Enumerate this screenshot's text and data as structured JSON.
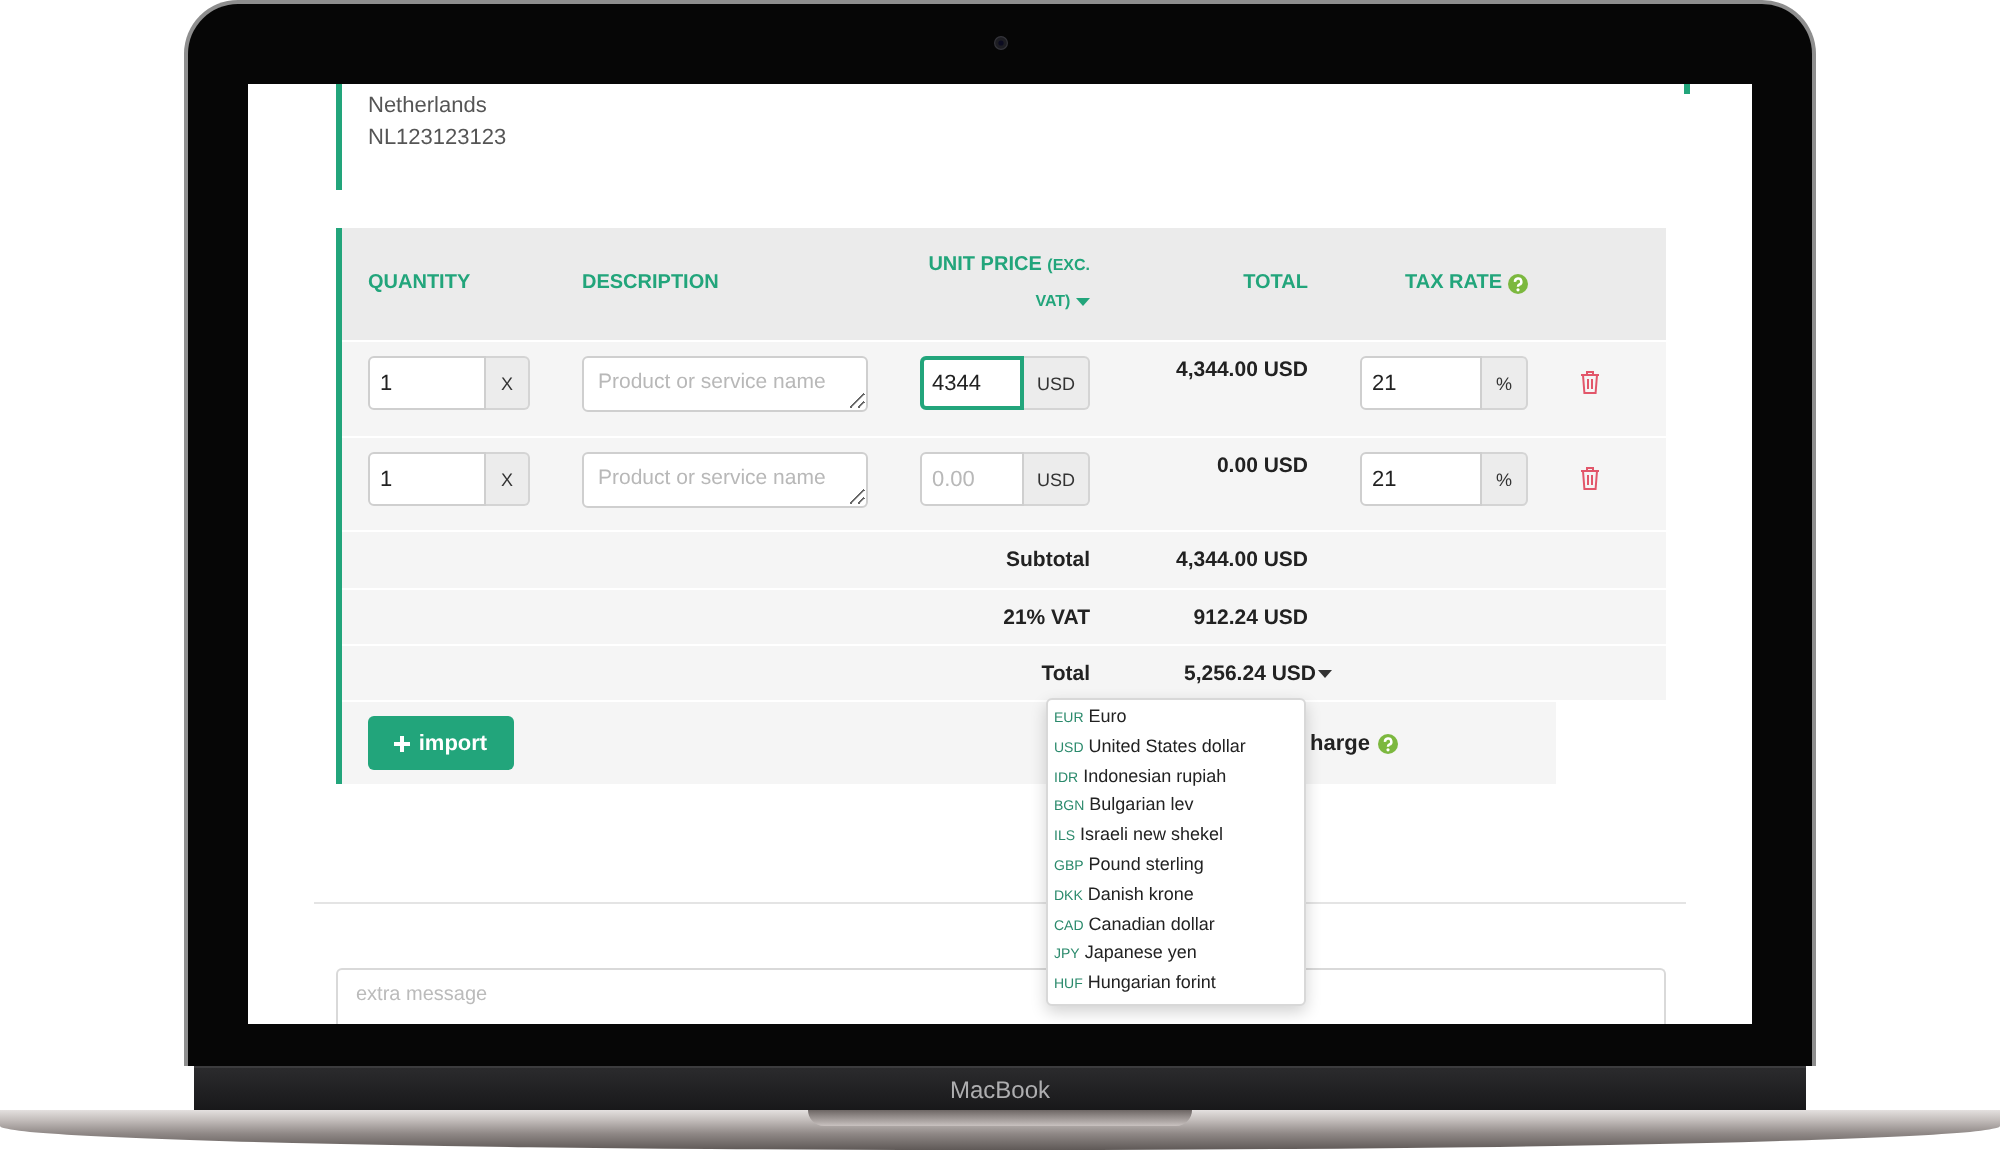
{
  "device": {
    "label": "MacBook"
  },
  "address": {
    "lines": [
      "Netherlands",
      "NL123123123"
    ]
  },
  "invoice_table": {
    "columns": [
      {
        "label": "QUANTITY",
        "kind": "plain"
      },
      {
        "label": "DESCRIPTION",
        "kind": "plain"
      },
      {
        "label": "UNIT PRICE",
        "note": "(EXC. VAT)",
        "kind": "dropdown"
      },
      {
        "label": "TOTAL",
        "kind": "plain"
      },
      {
        "label": "TAX RATE",
        "kind": "help"
      }
    ],
    "rows": [
      {
        "quantity": {
          "value": "1",
          "addon": "X"
        },
        "description": {
          "placeholder": "Product or service name"
        },
        "unit_price": {
          "value": "4344",
          "addon": "USD",
          "focused": true
        },
        "total": "4,344.00 USD",
        "tax_rate": {
          "value": "21",
          "addon": "%"
        }
      },
      {
        "quantity": {
          "value": "1",
          "addon": "X"
        },
        "description": {
          "placeholder": "Product or service name"
        },
        "unit_price": {
          "placeholder": "0.00",
          "addon": "USD",
          "focused": false
        },
        "total": "0.00 USD",
        "tax_rate": {
          "value": "21",
          "addon": "%"
        }
      }
    ],
    "totals": [
      {
        "label": "Subtotal",
        "value": "4,344.00 USD",
        "kind": "plain"
      },
      {
        "label": "21% VAT",
        "value": "912.24 USD",
        "kind": "plain"
      },
      {
        "label": "Total",
        "value": "5,256.24 USD",
        "kind": "dropdown"
      }
    ],
    "import_button": {
      "label": "import"
    },
    "footer_option": {
      "label": "harge",
      "help": true
    }
  },
  "currency_menu": {
    "open": true,
    "items": [
      {
        "code": "EUR",
        "name": "Euro"
      },
      {
        "code": "USD",
        "name": "United States dollar"
      },
      {
        "code": "IDR",
        "name": "Indonesian rupiah"
      },
      {
        "code": "BGN",
        "name": "Bulgarian lev"
      },
      {
        "code": "ILS",
        "name": "Israeli new shekel"
      },
      {
        "code": "GBP",
        "name": "Pound sterling"
      },
      {
        "code": "DKK",
        "name": "Danish krone"
      },
      {
        "code": "CAD",
        "name": "Canadian dollar"
      },
      {
        "code": "JPY",
        "name": "Japanese yen"
      },
      {
        "code": "HUF",
        "name": "Hungarian forint"
      }
    ]
  },
  "extra_message": {
    "placeholder": "extra message"
  }
}
